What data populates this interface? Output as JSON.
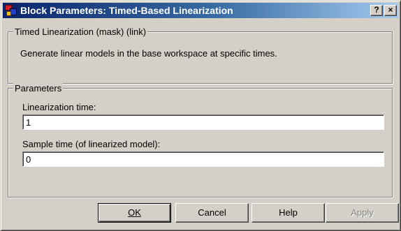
{
  "window": {
    "title": "Block Parameters: Timed-Based Linearization",
    "help_button": "?",
    "close_button": "×"
  },
  "description_group": {
    "title": "Timed Linearization (mask) (link)",
    "text": "Generate linear models in the base workspace at specific times."
  },
  "parameters_group": {
    "title": "Parameters",
    "fields": [
      {
        "label": "Linearization time:",
        "value": "1"
      },
      {
        "label": "Sample time (of linearized model):",
        "value": "0"
      }
    ]
  },
  "buttons": {
    "ok": "OK",
    "cancel": "Cancel",
    "help": "Help",
    "apply": "Apply"
  }
}
